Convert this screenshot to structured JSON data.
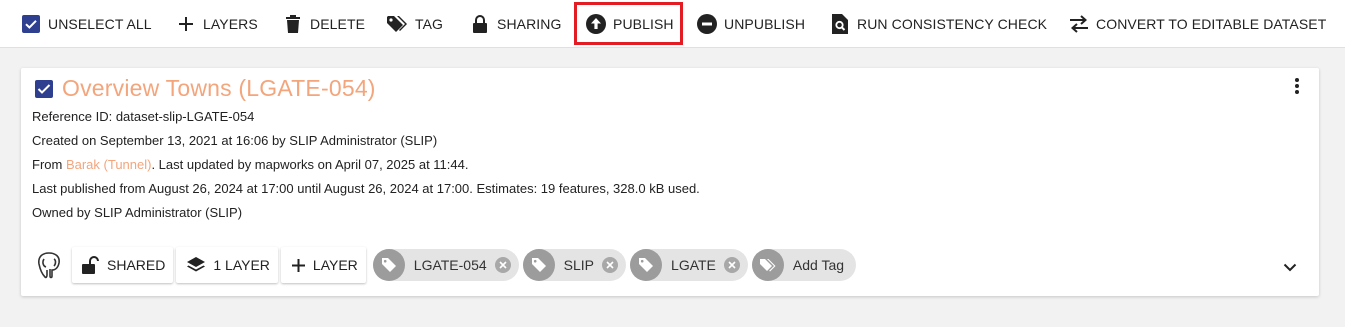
{
  "toolbar": {
    "unselect_all": "UNSELECT ALL",
    "layers": "LAYERS",
    "delete": "DELETE",
    "tag": "TAG",
    "sharing": "SHARING",
    "publish": "PUBLISH",
    "unpublish": "UNPUBLISH",
    "run_consistency_check": "RUN CONSISTENCY CHECK",
    "convert": "CONVERT TO EDITABLE DATASET"
  },
  "dataset": {
    "title": "Overview Towns (LGATE-054)",
    "reference": "Reference ID: dataset-slip-LGATE-054",
    "created": "Created on September 13, 2021 at 16:06 by SLIP Administrator (SLIP)",
    "from_prefix": "From ",
    "from_link": "Barak (Tunnel)",
    "from_suffix": ". Last updated by mapworks on April 07, 2025 at 11:44.",
    "published": "Last published from August 26, 2024 at 17:00 until August 26, 2024 at 17:00. Estimates: 19 features, 328.0 kB used.",
    "owned": "Owned by SLIP Administrator (SLIP)"
  },
  "footer": {
    "shared": "SHARED",
    "layer_count": "1 LAYER",
    "add_layer": "LAYER",
    "tags": [
      "LGATE-054",
      "SLIP",
      "LGATE"
    ],
    "add_tag": "Add Tag"
  },
  "colors": {
    "accent": "#2e3f8f",
    "title": "#f3a57c",
    "highlight": "#e31b23"
  }
}
